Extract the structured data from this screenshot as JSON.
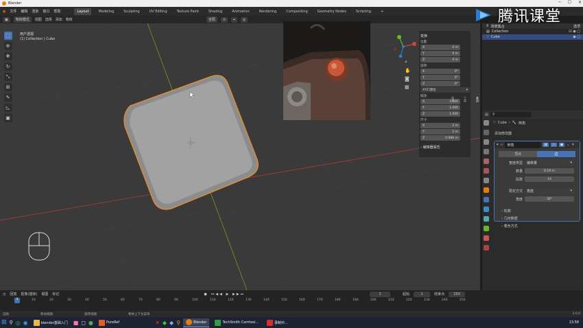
{
  "title": "Blender",
  "menu": [
    "文件",
    "编辑",
    "渲染",
    "窗口",
    "帮助"
  ],
  "workspaces": [
    {
      "label": "Layout",
      "active": true
    },
    {
      "label": "Modeling"
    },
    {
      "label": "Sculpting"
    },
    {
      "label": "UV Editing"
    },
    {
      "label": "Texture Paint"
    },
    {
      "label": "Shading"
    },
    {
      "label": "Animation"
    },
    {
      "label": "Rendering"
    },
    {
      "label": "Compositing"
    },
    {
      "label": "Geometry Nodes"
    },
    {
      "label": "Scripting"
    }
  ],
  "add_tab": "+",
  "header": {
    "mode": "物体模式",
    "view": "视图",
    "select": "选择",
    "add": "添加",
    "object": "物体",
    "orientation": "全局"
  },
  "viewport_info": {
    "line1": "用户透视",
    "line2": "(1) Collection | Cube"
  },
  "npanel": {
    "section": "变换",
    "location_label": "位置:",
    "location": [
      {
        "axis": "X",
        "value": "0 m"
      },
      {
        "axis": "Y",
        "value": "0 m"
      },
      {
        "axis": "Z",
        "value": "0 m"
      }
    ],
    "rotation_label": "旋转:",
    "rotation": [
      {
        "axis": "X",
        "value": "0°"
      },
      {
        "axis": "Y",
        "value": "0°"
      },
      {
        "axis": "Z",
        "value": "0°"
      }
    ],
    "rotation_mode": "XYZ 欧拉",
    "scale_label": "缩放:",
    "scale": [
      {
        "axis": "X",
        "value": "1.000"
      },
      {
        "axis": "Y",
        "value": "1.000"
      },
      {
        "axis": "Z",
        "value": "1.000"
      }
    ],
    "dimensions_label": "尺寸:",
    "dimensions": [
      {
        "axis": "X",
        "value": "2 m"
      },
      {
        "axis": "Y",
        "value": "2 m"
      },
      {
        "axis": "Z",
        "value": "0.686 m"
      }
    ],
    "props_section": "编辑器属性",
    "tabs": [
      "条目",
      "工具",
      "视图"
    ]
  },
  "outliner": {
    "header": "场景集合",
    "rows": [
      {
        "label": "Collection"
      },
      {
        "label": "Cube"
      }
    ],
    "options": "选项"
  },
  "props": {
    "breadcrumb_obj": "Cube",
    "breadcrumb_mod": "倒角",
    "add_modifier": "添加修改器",
    "modifier_name": "倒角",
    "seg_vertex": "顶点",
    "seg_edge": "边",
    "width_type_label": "宽度类型",
    "width_type": "偏移量",
    "amount_label": "数量",
    "amount": "0.19 m",
    "segments_label": "段数",
    "segments": "14",
    "limit_label": "限定方式",
    "limit": "角度",
    "angle_label": "角度",
    "angle": "30°",
    "profile": "轮廓",
    "geometry": "几何数据",
    "shading": "着色方式"
  },
  "timeline": {
    "menu": [
      "回放",
      "抠像(插帧)",
      "视图",
      "标记"
    ],
    "frames": [
      "1",
      "10",
      "20",
      "30",
      "40",
      "50",
      "60",
      "70",
      "80",
      "90",
      "100",
      "110",
      "120",
      "130",
      "140",
      "150",
      "160",
      "170",
      "180",
      "190",
      "200",
      "210",
      "220",
      "230",
      "240",
      "250"
    ],
    "current": "1",
    "start_label": "起始",
    "start": "1",
    "end_label": "结束点",
    "end": "250",
    "frame_field": "1"
  },
  "status": {
    "left": [
      "选择",
      "移动视图",
      "旋转视图"
    ],
    "center": "物体上下文菜单",
    "version": "3.0.0"
  },
  "taskbar": {
    "items": [
      {
        "label": "blender基础入门"
      },
      {
        "label": "PureRef"
      },
      {
        "label": "Blender",
        "active": true
      },
      {
        "label": "TechSmith Camtasi..."
      },
      {
        "label": "录制中..."
      }
    ],
    "time": "13:58"
  },
  "watermark": "腾讯课堂",
  "colors": {
    "accent": "#4772b3",
    "selection_outline": "#e8902a",
    "x_axis": "#b33a3a",
    "y_axis": "#6b8f2a"
  }
}
